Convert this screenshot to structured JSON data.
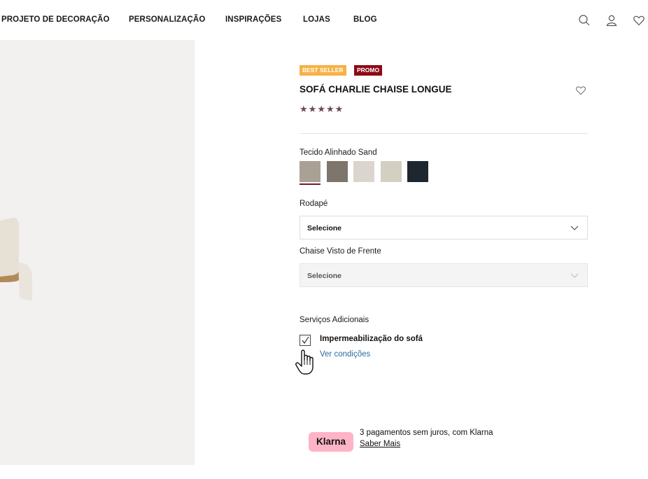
{
  "nav": {
    "items": [
      {
        "label": "PROJETO DE DECORAÇÃO"
      },
      {
        "label": "PERSONALIZAÇÃO"
      },
      {
        "label": "INSPIRAÇÕES"
      },
      {
        "label": "LOJAS"
      },
      {
        "label": "BLOG"
      }
    ],
    "icons": [
      "search-icon",
      "user-icon",
      "heart-icon"
    ]
  },
  "product": {
    "badges": {
      "best_seller": "BEST SELLER",
      "promo": "PROMO"
    },
    "title": "SOFÁ CHARLIE CHAISE LONGUE",
    "rating_stars": 5,
    "star_glyph": "★",
    "fabric_label": "Tecido Alinhado Sand",
    "swatches": [
      {
        "color": "#a9a096",
        "selected": true
      },
      {
        "color": "#7e766c"
      },
      {
        "color": "#dcd5cd"
      },
      {
        "color": "#d3d0c2"
      },
      {
        "color": "#1e2630"
      }
    ],
    "rodape": {
      "label": "Rodapé",
      "value": "Selecione"
    },
    "chaise": {
      "label": "Chaise Visto de Frente",
      "value": "Selecione"
    },
    "services": {
      "label": "Serviços Adicionais",
      "option_label": "Impermeabilização do sofá",
      "checked": true,
      "link": "Ver condições"
    },
    "klarna": {
      "logo": "Klarna",
      "text": "3 pagamentos sem juros, com Klarna",
      "link": "Saber Mais"
    }
  },
  "colors": {
    "best_seller": "#f7b147",
    "promo": "#8d0a14",
    "klarna_pink": "#ffb3c7",
    "link_blue": "#2b6aa0",
    "star": "#6b4a52"
  }
}
